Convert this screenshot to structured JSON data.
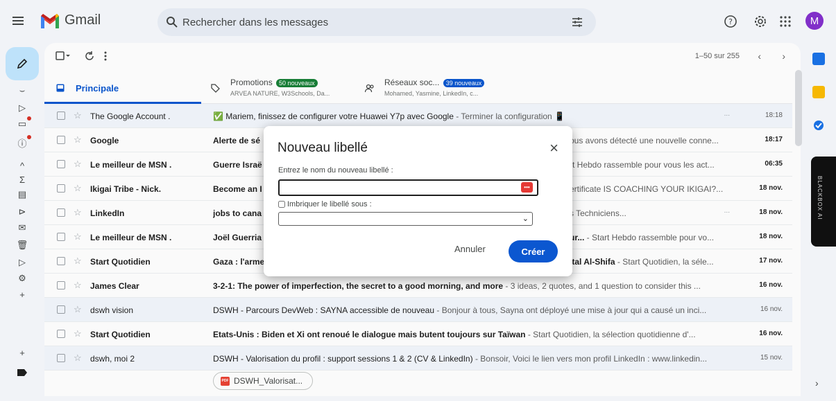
{
  "app": {
    "name": "Gmail",
    "avatar_letter": "M"
  },
  "search": {
    "placeholder": "Rechercher dans les messages"
  },
  "toolbar": {
    "pagination": "1–50 sur 255",
    "prev": "‹",
    "next": "›"
  },
  "tabs": {
    "primary": {
      "label": "Principale"
    },
    "promotions": {
      "label": "Promotions",
      "badge": "50 nouveaux",
      "desc": "ARVEA NATURE, W3Schools, Da...",
      "badge_color": "#188038"
    },
    "social": {
      "label": "Réseaux soc...",
      "badge": "39 nouveaux",
      "desc": "Mohamed, Yasmine, LinkedIn, c...",
      "badge_color": "#0b57d0"
    }
  },
  "emails": [
    {
      "sender": "The Google Account .",
      "subject": "✅ Mariem, finissez de configurer votre Huawei Y7p avec Google",
      "snippet": " - Terminer la configuration 📱",
      "date": "18:18",
      "unread": false,
      "dots": "..."
    },
    {
      "sender": "Google",
      "subject": "Alerte de sé",
      "snippet": "",
      "right_snippet": "ous avons détecté une nouvelle conne...",
      "date": "18:17",
      "unread": true
    },
    {
      "sender": "Le meilleur de MSN .",
      "subject": "Guerre Israë",
      "snippet": "",
      "right_snippet": "rt Hebdo rassemble pour vous les act...",
      "date": "06:35",
      "unread": true
    },
    {
      "sender": "Ikigai Tribe - Nick.",
      "subject": "Become an I",
      "snippet": "",
      "right_snippet": "ertificate IS COACHING YOUR IKIGAI?...",
      "date": "18 nov.",
      "unread": true
    },
    {
      "sender": "LinkedIn",
      "subject": "jobs to cana",
      "snippet": "",
      "right_snippet": "s Techniciens...",
      "date": "18 nov.",
      "unread": true,
      "dots": "..."
    },
    {
      "sender": "Le meilleur de MSN .",
      "subject": "Joël Guerria",
      "snippet": "",
      "right_snippet_bold": "ur...",
      "right_snippet": " - Start Hebdo rassemble pour vo...",
      "date": "18 nov.",
      "unread": true
    },
    {
      "sender": "Start Quotidien",
      "subject": "Gaza : l'arme",
      "snippet": "",
      "right_snippet_bold": "ital Al-Shifa",
      "right_snippet": " - Start Quotidien, la séle...",
      "date": "17 nov.",
      "unread": true
    },
    {
      "sender": "James Clear",
      "subject": "3-2-1: The power of imperfection, the secret to a good morning, and more",
      "snippet": " - 3 ideas, 2 quotes, and 1 question to consider this ...",
      "date": "16 nov.",
      "unread": true
    },
    {
      "sender": "dswh vision",
      "subject": "DSWH - Parcours DevWeb : SAYNA accessible de nouveau",
      "snippet": " - Bonjour à tous, Sayna ont déployé une mise à jour qui a causé un inci...",
      "date": "16 nov.",
      "unread": false
    },
    {
      "sender": "Start Quotidien",
      "subject": "Etats-Unis : Biden et Xi ont renoué le dialogue mais butent toujours sur Taïwan",
      "snippet": " - Start Quotidien, la sélection quotidienne d'...",
      "date": "16 nov.",
      "unread": true
    },
    {
      "sender": "dswh, moi 2",
      "subject": "DSWH - Valorisation du profil : support sessions 1 & 2 (CV & LinkedIn)",
      "snippet": " - Bonsoir, Voici le lien vers mon profil LinkedIn : www.linkedin...",
      "date": "15 nov.",
      "unread": false
    }
  ],
  "attachment": {
    "name": "DSWH_Valorisat...",
    "type": "PDF"
  },
  "side_panel": {
    "blackbox_label": "BLACKBOX AI"
  },
  "dialog": {
    "title": "Nouveau libellé",
    "input_label": "Entrez le nom du nouveau libellé :",
    "input_value": "",
    "nest_label": "Imbriquer le libellé sous :",
    "cancel_label": "Annuler",
    "create_label": "Créer"
  },
  "colors": {
    "accent": "#0b57d0",
    "compose_bg": "#c2e7ff",
    "avatar_bg": "#8430ce"
  }
}
